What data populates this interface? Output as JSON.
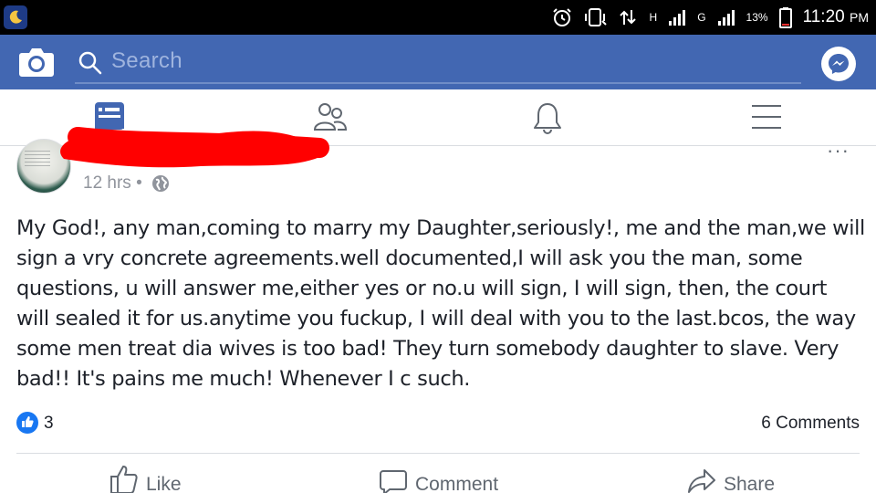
{
  "status_bar": {
    "battery": "13%",
    "time": "11:20",
    "ampm": "PM",
    "network_1": "H",
    "network_2": "G"
  },
  "search": {
    "placeholder": "Search"
  },
  "post": {
    "time": "12 hrs",
    "dot": "•",
    "text": "My God!, any man,coming to marry my Daughter,seriously!, me and the man,we will sign a vry concrete agreements.well documented,I will ask you the man, some questions, u will answer me,either yes or no.u will sign, I will sign, then, the court will sealed it for us.anytime you fuckup, I will deal with you to the last.bcos, the way some men treat dia wives is too bad! They turn somebody daughter to slave. Very bad!! It's pains me much! Whenever I c such.",
    "like_count": "3",
    "comments": "6 Comments",
    "more": "···"
  },
  "actions": {
    "like": "Like",
    "comment": "Comment",
    "share": "Share"
  },
  "colors": {
    "brand": "#4267b2",
    "like_blue": "#1877f2",
    "redaction": "#ff0000"
  }
}
